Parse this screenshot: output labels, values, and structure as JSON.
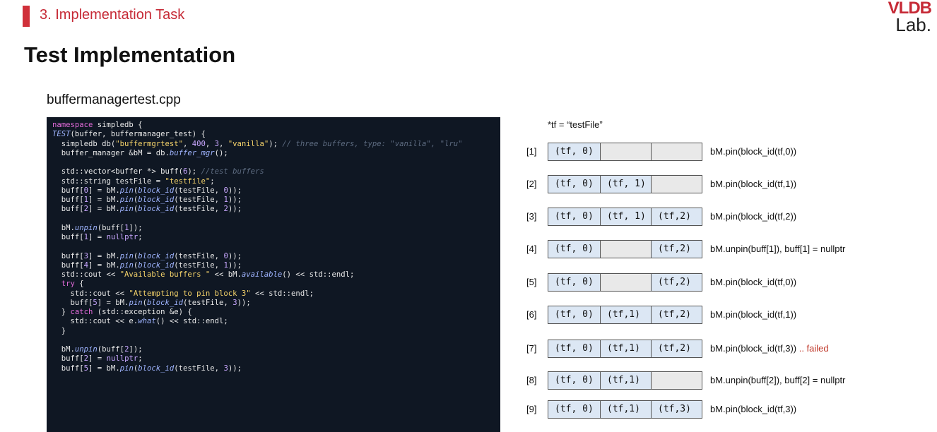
{
  "header": {
    "section": "3.  Implementation Task",
    "logo_top": "VLDB",
    "logo_bottom": "Lab."
  },
  "title": "Test Implementation",
  "filename": "buffermanagertest.cpp",
  "code_lines": [
    "namespace simpledb {",
    "TEST(buffer, buffermanager_test) {",
    "  simpledb db(\"buffermgrtest\", 400, 3, \"vanilla\"); // three buffers, type: \"vanilla\", \"lru\"",
    "  buffer_manager &bM = db.buffer_mgr();",
    "",
    "  std::vector<buffer *> buff(6); //test buffers",
    "  std::string testFile = \"testfile\";",
    "  buff[0] = bM.pin(block_id(testFile, 0));",
    "  buff[1] = bM.pin(block_id(testFile, 1));",
    "  buff[2] = bM.pin(block_id(testFile, 2));",
    "",
    "  bM.unpin(buff[1]);",
    "  buff[1] = nullptr;",
    "",
    "  buff[3] = bM.pin(block_id(testFile, 0));",
    "  buff[4] = bM.pin(block_id(testFile, 1));",
    "  std::cout << \"Available buffers \" << bM.available() << std::endl;",
    "  try {",
    "    std::cout << \"Attempting to pin block 3\" << std::endl;",
    "    buff[5] = bM.pin(block_id(testFile, 3));",
    "  } catch (std::exception &e) {",
    "    std::cout << e.what() << std::endl;",
    "  }",
    "",
    "  bM.unpin(buff[2]);",
    "  buff[2] = nullptr;",
    "  buff[5] = bM.pin(block_id(testFile, 3));"
  ],
  "note": "*tf = “testFile”",
  "steps": [
    {
      "index": "[1]",
      "cells": [
        "(tf, 0)",
        "",
        ""
      ],
      "op": "bM.pin(block_id(tf,0))",
      "failed": ""
    },
    {
      "index": "[2]",
      "cells": [
        "(tf, 0)",
        "(tf, 1)",
        ""
      ],
      "op": "bM.pin(block_id(tf,1))",
      "failed": ""
    },
    {
      "index": "[3]",
      "cells": [
        "(tf, 0)",
        "(tf, 1)",
        "(tf,2)"
      ],
      "op": "bM.pin(block_id(tf,2))",
      "failed": ""
    },
    {
      "index": "[4]",
      "cells": [
        "(tf, 0)",
        "",
        "(tf,2)"
      ],
      "op": "bM.unpin(buff[1]), buff[1] = nullptr",
      "failed": ""
    },
    {
      "index": "[5]",
      "cells": [
        "(tf, 0)",
        "",
        "(tf,2)"
      ],
      "op": "bM.pin(block_id(tf,0))",
      "failed": ""
    },
    {
      "index": "[6]",
      "cells": [
        "(tf, 0)",
        "(tf,1)",
        "(tf,2)"
      ],
      "op": "bM.pin(block_id(tf,1))",
      "failed": ""
    },
    {
      "index": "[7]",
      "cells": [
        "(tf, 0)",
        "(tf,1)",
        "(tf,2)"
      ],
      "op": "bM.pin(block_id(tf,3))",
      "failed": " .. failed"
    },
    {
      "index": "[8]",
      "cells": [
        "(tf, 0)",
        "(tf,1)",
        ""
      ],
      "op": "bM.unpin(buff[2]), buff[2] = nullptr",
      "failed": ""
    },
    {
      "index": "[9]",
      "cells": [
        "(tf, 0)",
        "(tf,1)",
        "(tf,3)"
      ],
      "op": "bM.pin(block_id(tf,3))",
      "failed": ""
    }
  ]
}
